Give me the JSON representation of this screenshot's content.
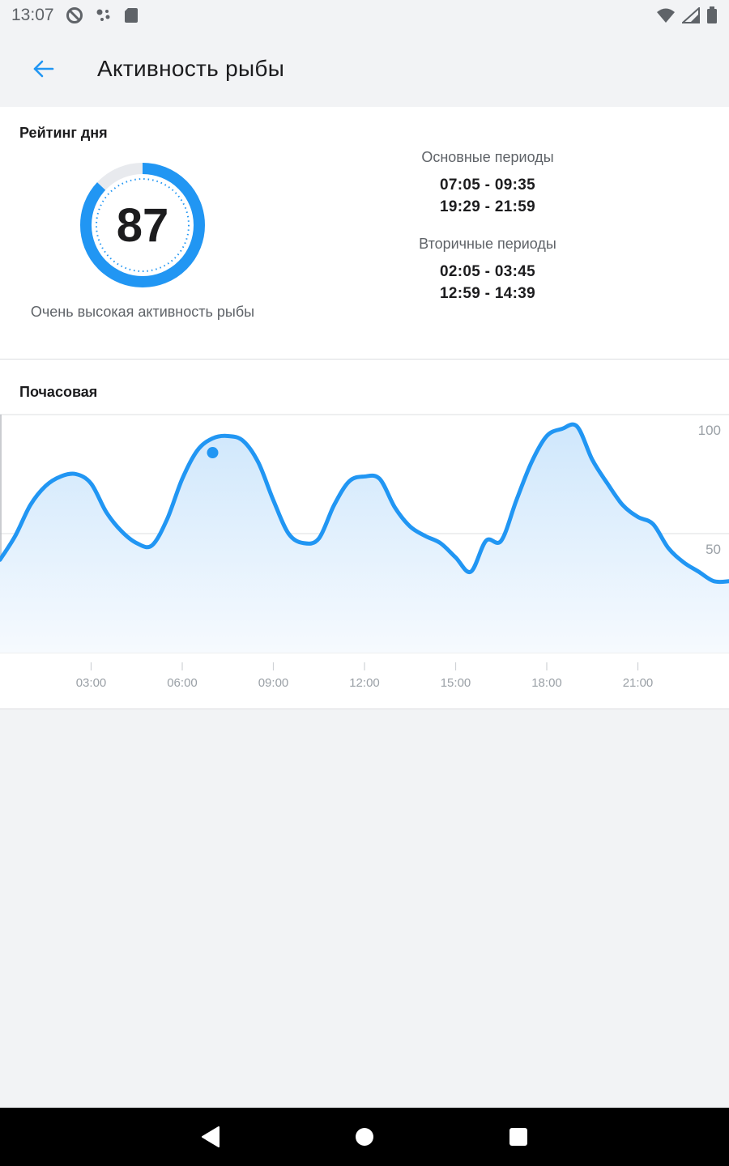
{
  "status_bar": {
    "time": "13:07",
    "icons_left": [
      "do-not-disturb-icon",
      "assistant-dots-icon",
      "sd-card-icon"
    ],
    "icons_right": [
      "wifi-icon",
      "cell-signal-icon",
      "battery-icon"
    ]
  },
  "app_bar": {
    "back_icon": "arrow-left-icon",
    "title": "Активность рыбы"
  },
  "rating": {
    "section_title": "Рейтинг дня",
    "value": "87",
    "value_percent": 87,
    "label": "Очень высокая активность рыбы",
    "main_periods": {
      "title": "Основные периоды",
      "items": [
        "07:05 - 09:35",
        "19:29 - 21:59"
      ]
    },
    "secondary_periods": {
      "title": "Вторичные периоды",
      "items": [
        "02:05 - 03:45",
        "12:59 - 14:39"
      ]
    }
  },
  "hourly": {
    "section_title": "Почасовая"
  },
  "chart_data": {
    "type": "area",
    "x_ticks": [
      "03:00",
      "06:00",
      "09:00",
      "12:00",
      "15:00",
      "18:00",
      "21:00"
    ],
    "y_ticks": [
      "100",
      "50"
    ],
    "ylim": [
      0,
      100
    ],
    "xlim": [
      0,
      24
    ],
    "grid": true,
    "x": [
      0,
      0.5,
      1,
      1.5,
      2,
      2.5,
      3,
      3.5,
      4,
      4.5,
      5,
      5.5,
      6,
      6.5,
      7,
      7.5,
      8,
      8.5,
      9,
      9.5,
      10,
      10.5,
      11,
      11.5,
      12,
      12.5,
      13,
      13.5,
      14,
      14.5,
      15,
      15.5,
      16,
      16.5,
      17,
      17.5,
      18,
      18.5,
      19,
      19.5,
      20,
      20.5,
      21,
      21.5,
      22,
      22.5,
      23,
      23.5,
      24
    ],
    "y": [
      39,
      49,
      62,
      70,
      74,
      75,
      71,
      59,
      51,
      46,
      45,
      56,
      73,
      85,
      90,
      91,
      89,
      80,
      64,
      50,
      46,
      48,
      62,
      72,
      74,
      73,
      61,
      53,
      49,
      46,
      40,
      34,
      47,
      47,
      64,
      80,
      91,
      94,
      95,
      81,
      71,
      62,
      57,
      54,
      44,
      38,
      34,
      30,
      30
    ],
    "highlight_point": {
      "x": 7,
      "y": 84
    },
    "color": "#2196f3",
    "fill_top": "#cfe7fc",
    "fill_bottom": "#f6fafe"
  },
  "nav_bar": {
    "buttons": [
      "back-triangle-icon",
      "home-circle-icon",
      "recents-square-icon"
    ]
  }
}
